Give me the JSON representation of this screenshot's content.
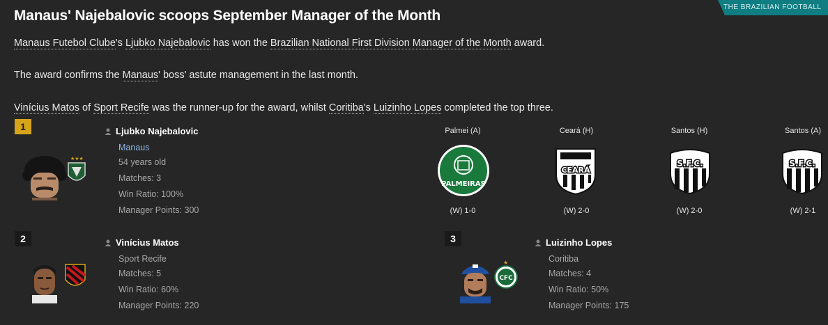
{
  "corner_tag": "THE BRAZILIAN FOOTBALL",
  "headline": "Manaus' Najebalovic scoops September Manager of the Month",
  "paragraphs": {
    "p1": {
      "club": "Manaus Futebol Clube",
      "sep1": "'s ",
      "manager": "Ljubko Najebalovic",
      "mid": " has won the ",
      "award": "Brazilian National First Division Manager of the Month",
      "end": " award."
    },
    "p2": {
      "start": "The award confirms the ",
      "club": "Manaus",
      "end": "' boss' astute management in the last month."
    },
    "p3": {
      "runner": "Vinícius Matos",
      "of": " of ",
      "runner_club": "Sport Recife",
      "mid": " was the runner-up for the award, whilst ",
      "third_club": "Coritiba",
      "sep": "'s ",
      "third": "Luizinho Lopes",
      "end": " completed the top three."
    }
  },
  "winners": [
    {
      "rank": "1",
      "name": "Ljubko Najebalovic",
      "club": "Manaus",
      "age": "54 years old",
      "matches": "Matches: 3",
      "win_ratio": "Win Ratio: 100%",
      "points": "Manager Points: 300"
    },
    {
      "rank": "2",
      "name": "Vinícius Matos",
      "club": "Sport Recife",
      "matches": "Matches: 5",
      "win_ratio": "Win Ratio: 60%",
      "points": "Manager Points: 220"
    },
    {
      "rank": "3",
      "name": "Luizinho Lopes",
      "club": "Coritiba",
      "matches": "Matches: 4",
      "win_ratio": "Win Ratio: 50%",
      "points": "Manager Points: 175"
    }
  ],
  "fixtures": [
    {
      "team": "Palmei (A)",
      "result": "(W) 1-0",
      "crest": "palmeiras-crest"
    },
    {
      "team": "Ceará (H)",
      "result": "(W) 2-0",
      "crest": "ceara-crest"
    },
    {
      "team": "Santos (H)",
      "result": "(W) 2-0",
      "crest": "santos-crest"
    },
    {
      "team": "Santos (A)",
      "result": "(W) 2-1",
      "crest": "santos-crest"
    }
  ],
  "crest_texts": {
    "palmeiras": "PALMEIRAS",
    "ceara": "CEARÁ",
    "santos": "S.F.C.",
    "coritiba": "CFC"
  },
  "colors": {
    "background": "#262626",
    "rank1": "#d6a419",
    "link": "#8fb8e8",
    "tag": "#0f7d82"
  }
}
